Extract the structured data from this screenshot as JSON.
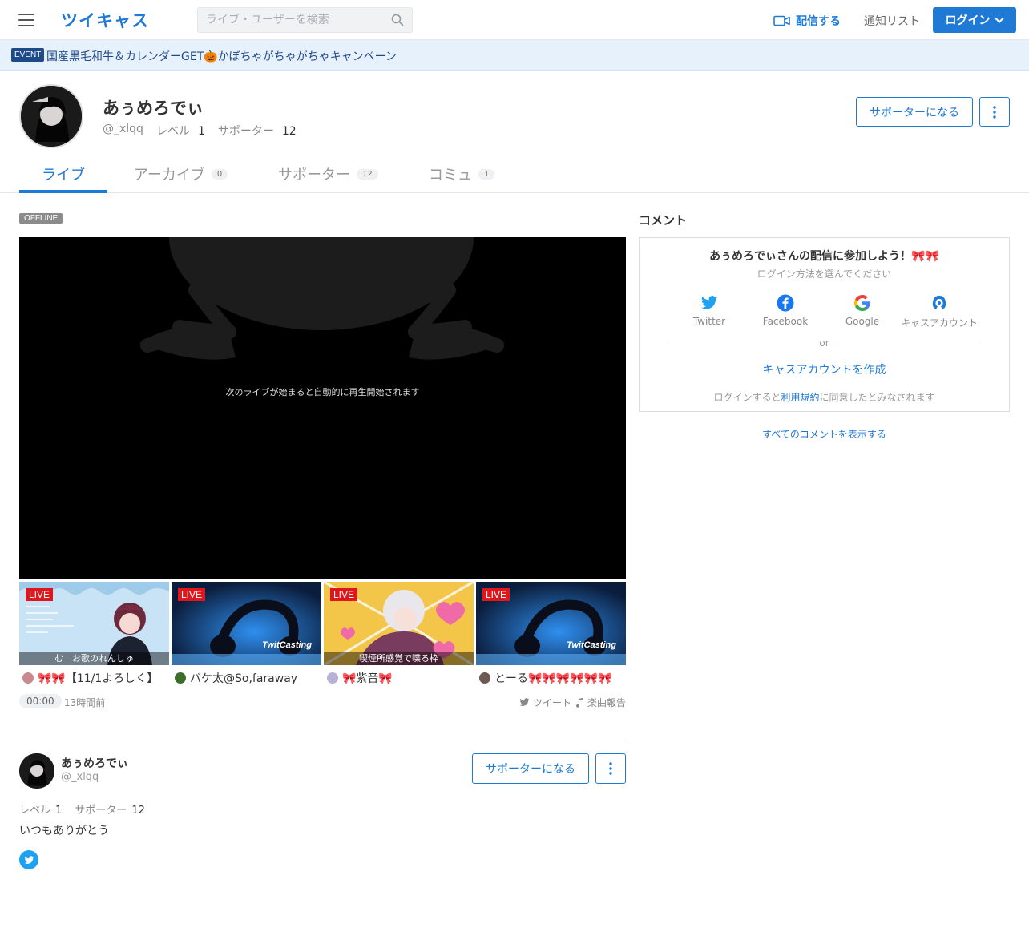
{
  "header": {
    "logo": "ツイキャス",
    "search_placeholder": "ライブ・ユーザーを検索",
    "broadcast_label": "配信する",
    "notify_label": "通知リスト",
    "login_label": "ログイン"
  },
  "event": {
    "badge": "EVENT",
    "text": "国産黒毛和牛＆カレンダーGET🎃かぼちゃがちゃがちゃキャンペーン"
  },
  "profile": {
    "name": "あぅめろでぃ",
    "handle": "@_xlqq",
    "level_label": "レベル",
    "level_value": "1",
    "supporter_label": "サポーター",
    "supporter_value": "12",
    "support_button": "サポーターになる"
  },
  "tabs": [
    {
      "label": "ライブ",
      "count": ""
    },
    {
      "label": "アーカイブ",
      "count": "0"
    },
    {
      "label": "サポーター",
      "count": "12"
    },
    {
      "label": "コミュ",
      "count": "1"
    }
  ],
  "player": {
    "status": "OFFLINE",
    "message": "次のライブが始まると自動的に再生開始されます"
  },
  "thumbnails": [
    {
      "live": "LIVE",
      "caption": "む　お歌のれんしゅ",
      "name": "🎀🎀【11/1よろしく】",
      "logo": ""
    },
    {
      "live": "LIVE",
      "caption": "",
      "name": "バケ太@So,faraway",
      "logo": "TwitCasting"
    },
    {
      "live": "LIVE",
      "caption": "喫煙所感覚で喋る枠",
      "name": "🎀紫音🎀",
      "logo": ""
    },
    {
      "live": "LIVE",
      "caption": "",
      "name": "とーる🎀🎀🎀🎀🎀🎀",
      "logo": "TwitCasting"
    }
  ],
  "meta": {
    "time": "00:00",
    "ago": "13時間前",
    "tweet_label": "ツイート",
    "report_label": "楽曲報告"
  },
  "bottom_profile": {
    "name": "あぅめろでぃ",
    "handle": "@_xlqq",
    "level_label": "レベル",
    "level_value": "1",
    "supporter_label": "サポーター",
    "supporter_value": "12",
    "bio": "いつもありがとう",
    "support_button": "サポーターになる"
  },
  "comments": {
    "title": "コメント",
    "join_text": "あぅめろでぃさんの配信に参加しよう！🎀🎀",
    "choose_text": "ログイン方法を選んでください",
    "providers": [
      {
        "label": "Twitter",
        "icon": "twitter-icon"
      },
      {
        "label": "Facebook",
        "icon": "facebook-icon"
      },
      {
        "label": "Google",
        "icon": "google-icon"
      },
      {
        "label": "キャスアカウント",
        "icon": "cas-account-icon"
      }
    ],
    "or_text": "or",
    "create_account": "キャスアカウントを作成",
    "terms_prefix": "ログインすると",
    "terms_link": "利用規約",
    "terms_suffix": "に同意したとみなされます",
    "show_all": "すべてのコメントを表示する"
  },
  "colors": {
    "accent": "#1f7ad6",
    "live_badge": "#e0161d",
    "event_bg": "#e7f1fb",
    "player_bg": "#000000"
  }
}
